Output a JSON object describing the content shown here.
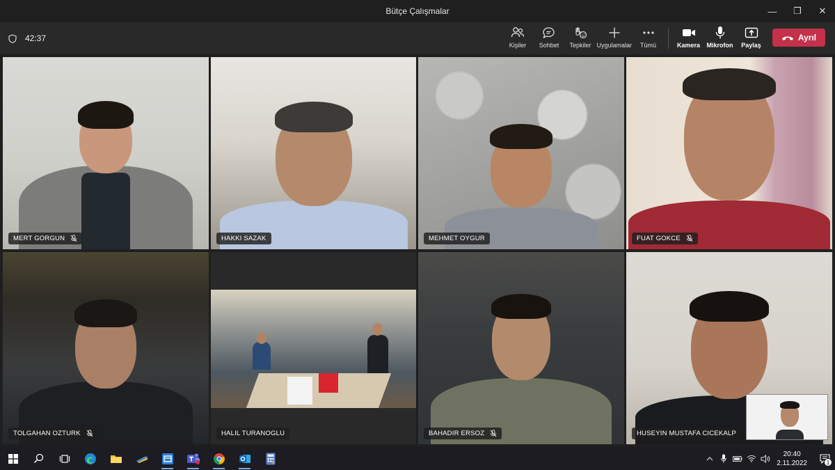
{
  "window": {
    "title": "Bütçe Çalışmalar",
    "minimize_glyph": "—",
    "maximize_glyph": "❐",
    "close_glyph": "✕"
  },
  "meeting": {
    "timer": "42:37",
    "tools": [
      {
        "label": "Kişiler",
        "icon": "people-icon"
      },
      {
        "label": "Sohbet",
        "icon": "chat-icon"
      },
      {
        "label": "Tepkiler",
        "icon": "reactions-icon"
      },
      {
        "label": "Uygulamalar",
        "icon": "apps-plus-icon"
      },
      {
        "label": "Tümü",
        "icon": "more-icon"
      }
    ],
    "media_controls": [
      {
        "label": "Kamera",
        "icon": "camera-icon"
      },
      {
        "label": "Mikrofon",
        "icon": "microphone-icon"
      },
      {
        "label": "Paylaş",
        "icon": "share-icon"
      }
    ],
    "leave_label": "Ayrıl"
  },
  "participants": [
    {
      "name": "MERT GORGUN",
      "muted": true
    },
    {
      "name": "HAKKI SAZAK",
      "muted": false
    },
    {
      "name": "MEHMET OYGUR",
      "muted": false
    },
    {
      "name": "FUAT GOKCE",
      "muted": true
    },
    {
      "name": "TOLGAHAN OZTURK",
      "muted": true
    },
    {
      "name": "HALIL TURANOGLU",
      "muted": false
    },
    {
      "name": "BAHADIR ERSOZ",
      "muted": true
    },
    {
      "name": "HUSEYIN MUSTAFA CICEKALP",
      "muted": false,
      "active_speaker": true
    }
  ],
  "taskbar": {
    "pinned_apps": [
      "windows-start-icon",
      "search-icon",
      "task-view-icon",
      "edge-icon",
      "file-explorer-icon",
      "app-icon",
      "app-icon",
      "teams-icon",
      "chrome-icon",
      "outlook-icon",
      "calculator-icon"
    ],
    "clock_time": "20:40",
    "clock_date": "2.11.2022",
    "notification_count": "1",
    "accent": "#7aa7e0"
  },
  "colors": {
    "leave_red": "#c4314b",
    "active_outline": "#7f85f5"
  }
}
